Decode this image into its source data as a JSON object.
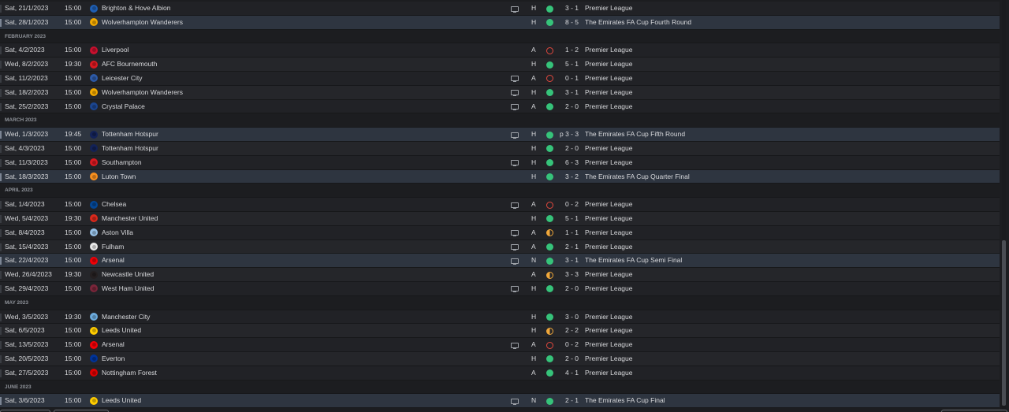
{
  "crest_colors": {
    "Brighton & Hove Albion": "#1f5fb4",
    "Wolverhampton Wanderers": "#f2a900",
    "Liverpool": "#c8102e",
    "AFC Bournemouth": "#d71920",
    "Leicester City": "#2d5aa8",
    "Crystal Palace": "#1b458f",
    "Tottenham Hotspur": "#132257",
    "Southampton": "#d71920",
    "Luton Town": "#f78f1e",
    "Chelsea": "#034694",
    "Manchester United": "#da291c",
    "Aston Villa": "#95bfe5",
    "Fulham": "#e8e8e8",
    "Arsenal": "#ef0107",
    "Newcastle United": "#241f20",
    "West Ham United": "#7a263a",
    "Manchester City": "#6cabdd",
    "Leeds United": "#ffcd00",
    "Everton": "#003399",
    "Nottingham Forest": "#dd0000"
  },
  "result_colors": {
    "win": "#36c37a",
    "loss": "#e0483e",
    "draw": "#f0a73a"
  },
  "rows": [
    {
      "type": "match",
      "date": "Sat, 21/1/2023",
      "time": "15:00",
      "team": "Brighton & Hove Albion",
      "tv": true,
      "venue": "H",
      "result": "win",
      "score": "3 - 1",
      "comp": "Premier League"
    },
    {
      "type": "match",
      "date": "Sat, 28/1/2023",
      "time": "15:00",
      "team": "Wolverhampton Wanderers",
      "tv": false,
      "venue": "H",
      "result": "win",
      "score": "8 - 5",
      "comp": "The Emirates FA Cup Fourth Round",
      "cup": true
    },
    {
      "type": "header",
      "label": "FEBRUARY 2023"
    },
    {
      "type": "match",
      "date": "Sat, 4/2/2023",
      "time": "15:00",
      "team": "Liverpool",
      "tv": false,
      "venue": "A",
      "result": "loss",
      "score": "1 - 2",
      "comp": "Premier League"
    },
    {
      "type": "match",
      "date": "Wed, 8/2/2023",
      "time": "19:30",
      "team": "AFC Bournemouth",
      "tv": false,
      "venue": "H",
      "result": "win",
      "score": "5 - 1",
      "comp": "Premier League"
    },
    {
      "type": "match",
      "date": "Sat, 11/2/2023",
      "time": "15:00",
      "team": "Leicester City",
      "tv": true,
      "venue": "A",
      "result": "loss",
      "score": "0 - 1",
      "comp": "Premier League"
    },
    {
      "type": "match",
      "date": "Sat, 18/2/2023",
      "time": "15:00",
      "team": "Wolverhampton Wanderers",
      "tv": true,
      "venue": "H",
      "result": "win",
      "score": "3 - 1",
      "comp": "Premier League"
    },
    {
      "type": "match",
      "date": "Sat, 25/2/2023",
      "time": "15:00",
      "team": "Crystal Palace",
      "tv": true,
      "venue": "A",
      "result": "win",
      "score": "2 - 0",
      "comp": "Premier League"
    },
    {
      "type": "header",
      "label": "MARCH 2023"
    },
    {
      "type": "match",
      "date": "Wed, 1/3/2023",
      "time": "19:45",
      "team": "Tottenham Hotspur",
      "tv": true,
      "venue": "H",
      "result": "win",
      "score": "p 3 - 3",
      "comp": "The Emirates FA Cup Fifth Round",
      "cup": true
    },
    {
      "type": "match",
      "date": "Sat, 4/3/2023",
      "time": "15:00",
      "team": "Tottenham Hotspur",
      "tv": false,
      "venue": "H",
      "result": "win",
      "score": "2 - 0",
      "comp": "Premier League"
    },
    {
      "type": "match",
      "date": "Sat, 11/3/2023",
      "time": "15:00",
      "team": "Southampton",
      "tv": true,
      "venue": "H",
      "result": "win",
      "score": "6 - 3",
      "comp": "Premier League"
    },
    {
      "type": "match",
      "date": "Sat, 18/3/2023",
      "time": "15:00",
      "team": "Luton Town",
      "tv": false,
      "venue": "H",
      "result": "win",
      "score": "3 - 2",
      "comp": "The Emirates FA Cup Quarter Final",
      "cup": true
    },
    {
      "type": "header",
      "label": "APRIL 2023"
    },
    {
      "type": "match",
      "date": "Sat, 1/4/2023",
      "time": "15:00",
      "team": "Chelsea",
      "tv": true,
      "venue": "A",
      "result": "loss",
      "score": "0 - 2",
      "comp": "Premier League"
    },
    {
      "type": "match",
      "date": "Wed, 5/4/2023",
      "time": "19:30",
      "team": "Manchester United",
      "tv": false,
      "venue": "H",
      "result": "win",
      "score": "5 - 1",
      "comp": "Premier League"
    },
    {
      "type": "match",
      "date": "Sat, 8/4/2023",
      "time": "15:00",
      "team": "Aston Villa",
      "tv": true,
      "venue": "A",
      "result": "draw",
      "score": "1 - 1",
      "comp": "Premier League"
    },
    {
      "type": "match",
      "date": "Sat, 15/4/2023",
      "time": "15:00",
      "team": "Fulham",
      "tv": true,
      "venue": "A",
      "result": "win",
      "score": "2 - 1",
      "comp": "Premier League"
    },
    {
      "type": "match",
      "date": "Sat, 22/4/2023",
      "time": "15:00",
      "team": "Arsenal",
      "tv": true,
      "venue": "N",
      "result": "win",
      "score": "3 - 1",
      "comp": "The Emirates FA Cup Semi Final",
      "cup": true
    },
    {
      "type": "match",
      "date": "Wed, 26/4/2023",
      "time": "19:30",
      "team": "Newcastle United",
      "tv": false,
      "venue": "A",
      "result": "draw",
      "score": "3 - 3",
      "comp": "Premier League"
    },
    {
      "type": "match",
      "date": "Sat, 29/4/2023",
      "time": "15:00",
      "team": "West Ham United",
      "tv": true,
      "venue": "H",
      "result": "win",
      "score": "2 - 0",
      "comp": "Premier League"
    },
    {
      "type": "header",
      "label": "MAY 2023"
    },
    {
      "type": "match",
      "date": "Wed, 3/5/2023",
      "time": "19:30",
      "team": "Manchester City",
      "tv": false,
      "venue": "H",
      "result": "win",
      "score": "3 - 0",
      "comp": "Premier League"
    },
    {
      "type": "match",
      "date": "Sat, 6/5/2023",
      "time": "15:00",
      "team": "Leeds United",
      "tv": false,
      "venue": "H",
      "result": "draw",
      "score": "2 - 2",
      "comp": "Premier League"
    },
    {
      "type": "match",
      "date": "Sat, 13/5/2023",
      "time": "15:00",
      "team": "Arsenal",
      "tv": true,
      "venue": "A",
      "result": "loss",
      "score": "0 - 2",
      "comp": "Premier League"
    },
    {
      "type": "match",
      "date": "Sat, 20/5/2023",
      "time": "15:00",
      "team": "Everton",
      "tv": false,
      "venue": "H",
      "result": "win",
      "score": "2 - 0",
      "comp": "Premier League"
    },
    {
      "type": "match",
      "date": "Sat, 27/5/2023",
      "time": "15:00",
      "team": "Nottingham Forest",
      "tv": false,
      "venue": "A",
      "result": "win",
      "score": "4 - 1",
      "comp": "Premier League"
    },
    {
      "type": "header",
      "label": "JUNE 2023"
    },
    {
      "type": "match",
      "date": "Sat, 3/6/2023",
      "time": "15:00",
      "team": "Leeds United",
      "tv": true,
      "venue": "N",
      "result": "win",
      "score": "2 - 1",
      "comp": "The Emirates FA Cup Final",
      "cup": true
    }
  ]
}
